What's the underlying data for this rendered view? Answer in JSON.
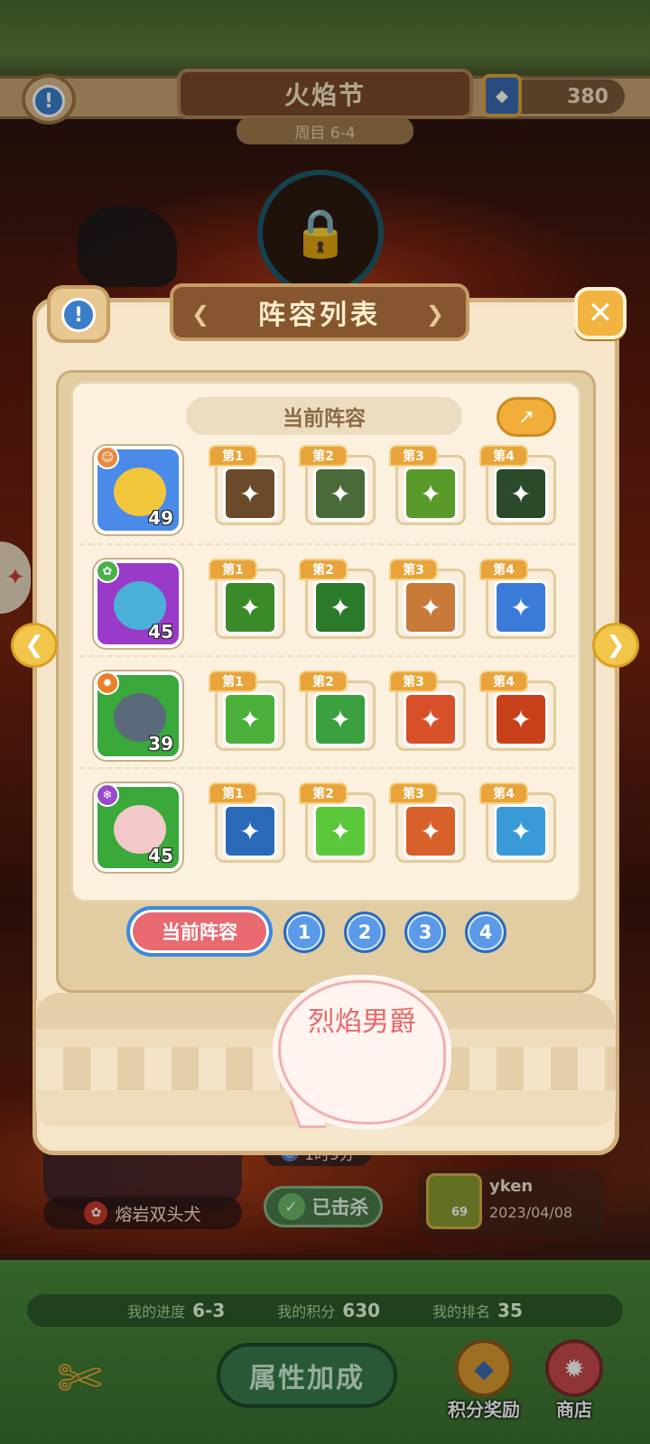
{
  "header": {
    "title": "火焰节",
    "subtitle": "周目 6-4",
    "currency": "380",
    "info_icon": "info-icon",
    "currency_icon": "gem-card-icon"
  },
  "background": {
    "chest_icon": "lock-icon",
    "boss_name": "熔岩双头犬",
    "timer": "1时9分",
    "killed_label": "已击杀",
    "player": {
      "name": "yken",
      "level": "69",
      "date": "2023/04/08"
    }
  },
  "bottom": {
    "progress_label": "我的进度",
    "progress_value": "6-3",
    "score_label": "我的积分",
    "score_value": "630",
    "rank_label": "我的排名",
    "rank_value": "35",
    "attr_button": "属性加成",
    "reward_button": "积分奖励",
    "shop_button": "商店"
  },
  "modal": {
    "title": "阵容列表",
    "current_lineup_header": "当前阵容",
    "share_icon": "share-icon",
    "close_icon": "close-icon",
    "rows": [
      {
        "level": "49",
        "colors": {
          "frame": "#4a8ae8",
          "face": "#f2c63a"
        },
        "skills": [
          {
            "tag": "第1",
            "color": "#6a4a2a"
          },
          {
            "tag": "第2",
            "color": "#4a6a3a"
          },
          {
            "tag": "第3",
            "color": "#5a9a2a"
          },
          {
            "tag": "第4",
            "color": "#2a4a2a"
          }
        ]
      },
      {
        "level": "45",
        "colors": {
          "frame": "#9a3ac8",
          "face": "#4ab0d8"
        },
        "skills": [
          {
            "tag": "第1",
            "color": "#3a8a2a"
          },
          {
            "tag": "第2",
            "color": "#2a7a2a"
          },
          {
            "tag": "第3",
            "color": "#c87a3a"
          },
          {
            "tag": "第4",
            "color": "#3a7ad8"
          }
        ]
      },
      {
        "level": "39",
        "colors": {
          "frame": "#3aa83a",
          "face": "#5a6a7a"
        },
        "skills": [
          {
            "tag": "第1",
            "color": "#4ab03a"
          },
          {
            "tag": "第2",
            "color": "#3aa040"
          },
          {
            "tag": "第3",
            "color": "#d8502a"
          },
          {
            "tag": "第4",
            "color": "#c8401a"
          }
        ]
      },
      {
        "level": "45",
        "colors": {
          "frame": "#3aa83a",
          "face": "#f2c8c8"
        },
        "skills": [
          {
            "tag": "第1",
            "color": "#2a6ab8"
          },
          {
            "tag": "第2",
            "color": "#5ac83a"
          },
          {
            "tag": "第3",
            "color": "#d8602a"
          },
          {
            "tag": "第4",
            "color": "#3a9ad8"
          }
        ]
      }
    ],
    "tabs": {
      "current": "当前阵容",
      "numbers": [
        "1",
        "2",
        "3",
        "4"
      ]
    },
    "speech": "烈焰男爵"
  }
}
